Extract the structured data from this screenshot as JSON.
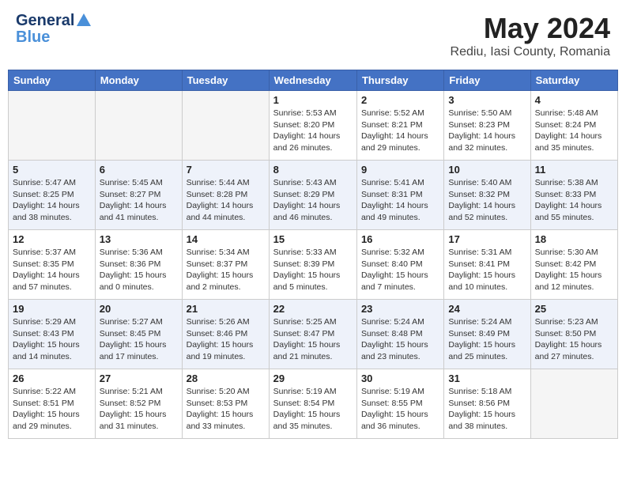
{
  "header": {
    "logo_general": "General",
    "logo_blue": "Blue",
    "month_year": "May 2024",
    "location": "Rediu, Iasi County, Romania"
  },
  "weekdays": [
    "Sunday",
    "Monday",
    "Tuesday",
    "Wednesday",
    "Thursday",
    "Friday",
    "Saturday"
  ],
  "weeks": [
    [
      {
        "day": "",
        "empty": true
      },
      {
        "day": "",
        "empty": true
      },
      {
        "day": "",
        "empty": true
      },
      {
        "day": "1",
        "sunrise": "Sunrise: 5:53 AM",
        "sunset": "Sunset: 8:20 PM",
        "daylight": "Daylight: 14 hours and 26 minutes."
      },
      {
        "day": "2",
        "sunrise": "Sunrise: 5:52 AM",
        "sunset": "Sunset: 8:21 PM",
        "daylight": "Daylight: 14 hours and 29 minutes."
      },
      {
        "day": "3",
        "sunrise": "Sunrise: 5:50 AM",
        "sunset": "Sunset: 8:23 PM",
        "daylight": "Daylight: 14 hours and 32 minutes."
      },
      {
        "day": "4",
        "sunrise": "Sunrise: 5:48 AM",
        "sunset": "Sunset: 8:24 PM",
        "daylight": "Daylight: 14 hours and 35 minutes."
      }
    ],
    [
      {
        "day": "5",
        "sunrise": "Sunrise: 5:47 AM",
        "sunset": "Sunset: 8:25 PM",
        "daylight": "Daylight: 14 hours and 38 minutes."
      },
      {
        "day": "6",
        "sunrise": "Sunrise: 5:45 AM",
        "sunset": "Sunset: 8:27 PM",
        "daylight": "Daylight: 14 hours and 41 minutes."
      },
      {
        "day": "7",
        "sunrise": "Sunrise: 5:44 AM",
        "sunset": "Sunset: 8:28 PM",
        "daylight": "Daylight: 14 hours and 44 minutes."
      },
      {
        "day": "8",
        "sunrise": "Sunrise: 5:43 AM",
        "sunset": "Sunset: 8:29 PM",
        "daylight": "Daylight: 14 hours and 46 minutes."
      },
      {
        "day": "9",
        "sunrise": "Sunrise: 5:41 AM",
        "sunset": "Sunset: 8:31 PM",
        "daylight": "Daylight: 14 hours and 49 minutes."
      },
      {
        "day": "10",
        "sunrise": "Sunrise: 5:40 AM",
        "sunset": "Sunset: 8:32 PM",
        "daylight": "Daylight: 14 hours and 52 minutes."
      },
      {
        "day": "11",
        "sunrise": "Sunrise: 5:38 AM",
        "sunset": "Sunset: 8:33 PM",
        "daylight": "Daylight: 14 hours and 55 minutes."
      }
    ],
    [
      {
        "day": "12",
        "sunrise": "Sunrise: 5:37 AM",
        "sunset": "Sunset: 8:35 PM",
        "daylight": "Daylight: 14 hours and 57 minutes."
      },
      {
        "day": "13",
        "sunrise": "Sunrise: 5:36 AM",
        "sunset": "Sunset: 8:36 PM",
        "daylight": "Daylight: 15 hours and 0 minutes."
      },
      {
        "day": "14",
        "sunrise": "Sunrise: 5:34 AM",
        "sunset": "Sunset: 8:37 PM",
        "daylight": "Daylight: 15 hours and 2 minutes."
      },
      {
        "day": "15",
        "sunrise": "Sunrise: 5:33 AM",
        "sunset": "Sunset: 8:39 PM",
        "daylight": "Daylight: 15 hours and 5 minutes."
      },
      {
        "day": "16",
        "sunrise": "Sunrise: 5:32 AM",
        "sunset": "Sunset: 8:40 PM",
        "daylight": "Daylight: 15 hours and 7 minutes."
      },
      {
        "day": "17",
        "sunrise": "Sunrise: 5:31 AM",
        "sunset": "Sunset: 8:41 PM",
        "daylight": "Daylight: 15 hours and 10 minutes."
      },
      {
        "day": "18",
        "sunrise": "Sunrise: 5:30 AM",
        "sunset": "Sunset: 8:42 PM",
        "daylight": "Daylight: 15 hours and 12 minutes."
      }
    ],
    [
      {
        "day": "19",
        "sunrise": "Sunrise: 5:29 AM",
        "sunset": "Sunset: 8:43 PM",
        "daylight": "Daylight: 15 hours and 14 minutes."
      },
      {
        "day": "20",
        "sunrise": "Sunrise: 5:27 AM",
        "sunset": "Sunset: 8:45 PM",
        "daylight": "Daylight: 15 hours and 17 minutes."
      },
      {
        "day": "21",
        "sunrise": "Sunrise: 5:26 AM",
        "sunset": "Sunset: 8:46 PM",
        "daylight": "Daylight: 15 hours and 19 minutes."
      },
      {
        "day": "22",
        "sunrise": "Sunrise: 5:25 AM",
        "sunset": "Sunset: 8:47 PM",
        "daylight": "Daylight: 15 hours and 21 minutes."
      },
      {
        "day": "23",
        "sunrise": "Sunrise: 5:24 AM",
        "sunset": "Sunset: 8:48 PM",
        "daylight": "Daylight: 15 hours and 23 minutes."
      },
      {
        "day": "24",
        "sunrise": "Sunrise: 5:24 AM",
        "sunset": "Sunset: 8:49 PM",
        "daylight": "Daylight: 15 hours and 25 minutes."
      },
      {
        "day": "25",
        "sunrise": "Sunrise: 5:23 AM",
        "sunset": "Sunset: 8:50 PM",
        "daylight": "Daylight: 15 hours and 27 minutes."
      }
    ],
    [
      {
        "day": "26",
        "sunrise": "Sunrise: 5:22 AM",
        "sunset": "Sunset: 8:51 PM",
        "daylight": "Daylight: 15 hours and 29 minutes."
      },
      {
        "day": "27",
        "sunrise": "Sunrise: 5:21 AM",
        "sunset": "Sunset: 8:52 PM",
        "daylight": "Daylight: 15 hours and 31 minutes."
      },
      {
        "day": "28",
        "sunrise": "Sunrise: 5:20 AM",
        "sunset": "Sunset: 8:53 PM",
        "daylight": "Daylight: 15 hours and 33 minutes."
      },
      {
        "day": "29",
        "sunrise": "Sunrise: 5:19 AM",
        "sunset": "Sunset: 8:54 PM",
        "daylight": "Daylight: 15 hours and 35 minutes."
      },
      {
        "day": "30",
        "sunrise": "Sunrise: 5:19 AM",
        "sunset": "Sunset: 8:55 PM",
        "daylight": "Daylight: 15 hours and 36 minutes."
      },
      {
        "day": "31",
        "sunrise": "Sunrise: 5:18 AM",
        "sunset": "Sunset: 8:56 PM",
        "daylight": "Daylight: 15 hours and 38 minutes."
      },
      {
        "day": "",
        "empty": true
      }
    ]
  ]
}
